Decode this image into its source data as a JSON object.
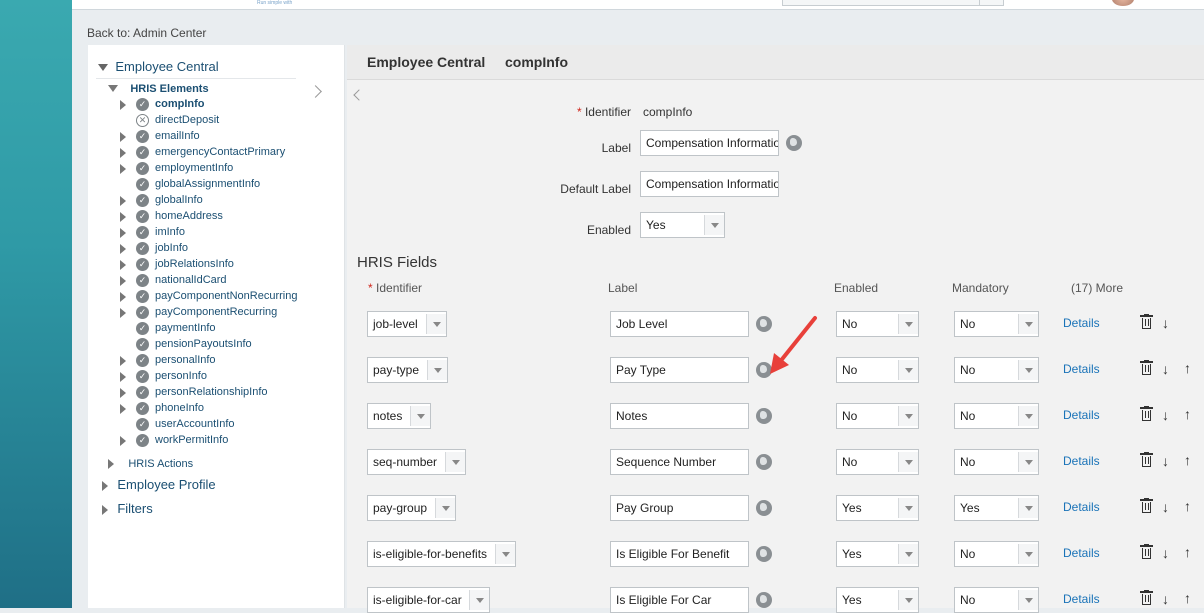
{
  "header": {
    "tagline": "Run simple with"
  },
  "back_link": "Back to: Admin Center",
  "sidebar": {
    "employee_central": "Employee Central",
    "hris_elements": "HRIS Elements",
    "items": [
      {
        "label": "compInfo",
        "expandable": true,
        "status": "check",
        "selected": true
      },
      {
        "label": "directDeposit",
        "expandable": false,
        "status": "x"
      },
      {
        "label": "emailInfo",
        "expandable": true,
        "status": "check"
      },
      {
        "label": "emergencyContactPrimary",
        "expandable": true,
        "status": "check"
      },
      {
        "label": "employmentInfo",
        "expandable": true,
        "status": "check"
      },
      {
        "label": "globalAssignmentInfo",
        "expandable": false,
        "status": "check"
      },
      {
        "label": "globalInfo",
        "expandable": true,
        "status": "check"
      },
      {
        "label": "homeAddress",
        "expandable": true,
        "status": "check"
      },
      {
        "label": "imInfo",
        "expandable": true,
        "status": "check"
      },
      {
        "label": "jobInfo",
        "expandable": true,
        "status": "check"
      },
      {
        "label": "jobRelationsInfo",
        "expandable": true,
        "status": "check"
      },
      {
        "label": "nationalIdCard",
        "expandable": true,
        "status": "check"
      },
      {
        "label": "payComponentNonRecurring",
        "expandable": true,
        "status": "check"
      },
      {
        "label": "payComponentRecurring",
        "expandable": true,
        "status": "check"
      },
      {
        "label": "paymentInfo",
        "expandable": false,
        "status": "check"
      },
      {
        "label": "pensionPayoutsInfo",
        "expandable": false,
        "status": "check"
      },
      {
        "label": "personalInfo",
        "expandable": true,
        "status": "check"
      },
      {
        "label": "personInfo",
        "expandable": true,
        "status": "check"
      },
      {
        "label": "personRelationshipInfo",
        "expandable": true,
        "status": "check"
      },
      {
        "label": "phoneInfo",
        "expandable": true,
        "status": "check"
      },
      {
        "label": "userAccountInfo",
        "expandable": false,
        "status": "check"
      },
      {
        "label": "workPermitInfo",
        "expandable": true,
        "status": "check"
      }
    ],
    "hris_actions": "HRIS Actions",
    "employee_profile": "Employee Profile",
    "filters": "Filters"
  },
  "main": {
    "breadcrumb_1": "Employee Central",
    "breadcrumb_2": "compInfo",
    "identifier_label": "Identifier",
    "identifier_value": "compInfo",
    "label_label": "Label",
    "label_value": "Compensation Information",
    "default_label_label": "Default Label",
    "default_label_value": "Compensation Information",
    "enabled_label": "Enabled",
    "enabled_value": "Yes",
    "hris_fields_title": "HRIS Fields",
    "columns": {
      "identifier": "Identifier",
      "label": "Label",
      "enabled": "Enabled",
      "mandatory": "Mandatory",
      "more": "(17) More"
    },
    "details_label": "Details",
    "fields": [
      {
        "identifier": "job-level",
        "label": "Job Level",
        "enabled": "No",
        "mandatory": "No"
      },
      {
        "identifier": "pay-type",
        "label": "Pay Type",
        "enabled": "No",
        "mandatory": "No"
      },
      {
        "identifier": "notes",
        "label": "Notes",
        "enabled": "No",
        "mandatory": "No"
      },
      {
        "identifier": "seq-number",
        "label": "Sequence Number",
        "enabled": "No",
        "mandatory": "No"
      },
      {
        "identifier": "pay-group",
        "label": "Pay Group",
        "enabled": "Yes",
        "mandatory": "Yes"
      },
      {
        "identifier": "is-eligible-for-benefits",
        "label": "Is Eligible For Benefit",
        "enabled": "Yes",
        "mandatory": "No"
      },
      {
        "identifier": "is-eligible-for-car",
        "label": "Is Eligible For Car",
        "enabled": "Yes",
        "mandatory": "No"
      }
    ]
  },
  "colors": {
    "accent_link": "#1a73b8",
    "tree_text": "#1b4f72",
    "annotation_arrow": "#e8403a"
  }
}
